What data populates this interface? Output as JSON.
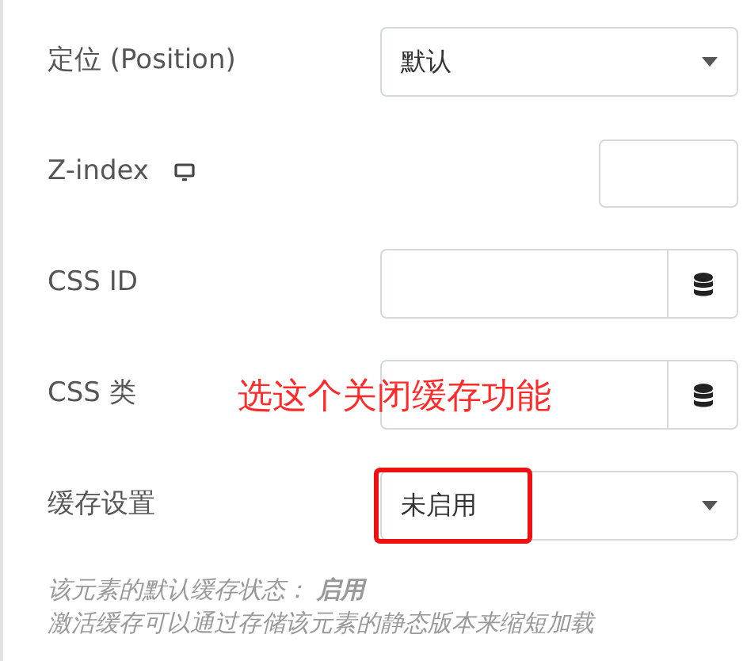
{
  "fields": [
    {
      "kind": "select",
      "label": "定位 (Position)",
      "value": "默认"
    },
    {
      "kind": "small",
      "label": "Z-index",
      "responsive_icon": true
    },
    {
      "kind": "dynamic",
      "label": "CSS ID"
    },
    {
      "kind": "dynamic",
      "label": "CSS 类",
      "annotation": "选这个关闭缓存功能"
    },
    {
      "kind": "select",
      "label": "缓存设置",
      "value": "未启用",
      "highlighted": true
    }
  ],
  "help": [
    "该元素的默认缓存状态： **启用**",
    "激活缓存可以通过存储该元素的静态版本来缩短加载"
  ]
}
